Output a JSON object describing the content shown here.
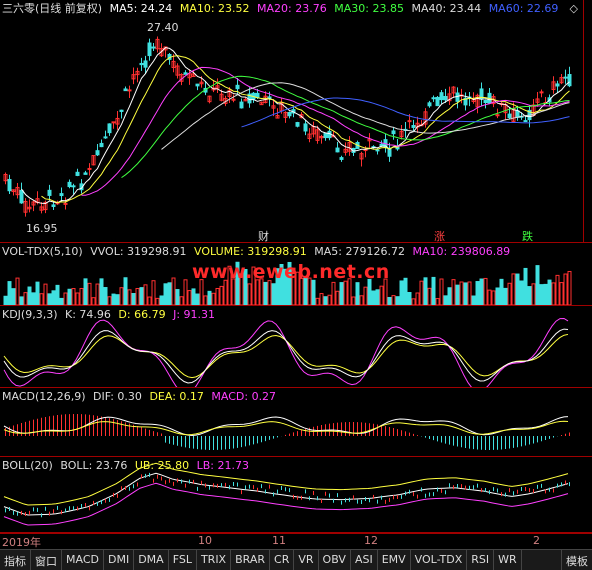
{
  "main": {
    "title": "三六零(日线 前复权)",
    "ma": [
      {
        "label": "MA5: 24.24",
        "color": "#ffffff"
      },
      {
        "label": "MA10: 23.52",
        "color": "#ffff40"
      },
      {
        "label": "MA20: 23.76",
        "color": "#ff40ff"
      },
      {
        "label": "MA30: 23.85",
        "color": "#40ff40"
      },
      {
        "label": "MA40: 23.44",
        "color": "#dddddd"
      },
      {
        "label": "MA60: 22.69",
        "color": "#4060ff"
      }
    ],
    "high_label": "27.40",
    "low_label": "16.95",
    "tag_cai": "财",
    "tag_zhang": "涨",
    "tag_die": "跌",
    "settings_icon": "diamond-icon"
  },
  "volume": {
    "name": "VOL-TDX(5,10)",
    "vvol": "VVOL: 319298.91",
    "volume": "VOLUME: 319298.91",
    "ma5": "MA5: 279126.72",
    "ma10": "MA10: 239806.89",
    "watermark": "www.eweb.net.cn"
  },
  "kdj": {
    "name": "KDJ(9,3,3)",
    "k": "K: 74.96",
    "d": "D: 66.79",
    "j": "J: 91.31"
  },
  "macd": {
    "name": "MACD(12,26,9)",
    "dif": "DIF: 0.30",
    "dea": "DEA: 0.17",
    "macd": "MACD: 0.27"
  },
  "boll": {
    "name": "BOLL(20)",
    "boll": "BOLL: 23.76",
    "ub": "UB: 25.80",
    "lb": "LB: 21.73"
  },
  "time_axis": [
    "2019年",
    "10",
    "11",
    "12",
    "2"
  ],
  "tabs": [
    "指标",
    "窗口",
    "MACD",
    "DMI",
    "DMA",
    "FSL",
    "TRIX",
    "BRAR",
    "CR",
    "VR",
    "OBV",
    "ASI",
    "EMV",
    "VOL-TDX",
    "RSI",
    "WR"
  ],
  "tab_right": "模板"
}
